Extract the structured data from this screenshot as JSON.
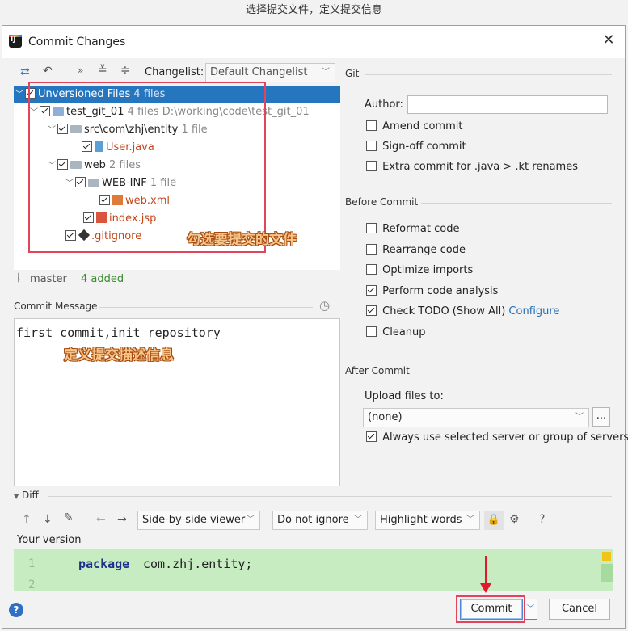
{
  "caption": "选择提交文件，定义提交信息",
  "window": {
    "title": "Commit Changes"
  },
  "toolbar": {
    "changelist_label": "Changelist:",
    "changelist_value": "Default Changelist"
  },
  "tree": {
    "root": {
      "label": "Unversioned Files",
      "count": "4 files"
    },
    "module": {
      "label": "test_git_01",
      "count": "4 files",
      "path": "D:\\working\\code\\test_git_01"
    },
    "pkg": {
      "label": "src\\com\\zhj\\entity",
      "count": "1 file"
    },
    "user_java": "User.java",
    "web": {
      "label": "web",
      "count": "2 files"
    },
    "webinf": {
      "label": "WEB-INF",
      "count": "1 file"
    },
    "web_xml": "web.xml",
    "index_jsp": "index.jsp",
    "gitignore": ".gitignore"
  },
  "annotations": {
    "select_files": "勾选要提交的文件",
    "define_message": "定义提交描述信息"
  },
  "status": {
    "branch": "master",
    "added": "4 added"
  },
  "commit_message": {
    "label": "Commit Message",
    "text": "first commit,init repository"
  },
  "git": {
    "section": "Git",
    "author_label": "Author:",
    "amend": "Amend commit",
    "signoff": "Sign-off commit",
    "extra": "Extra commit for .java > .kt renames"
  },
  "before_commit": {
    "section": "Before Commit",
    "reformat": "Reformat code",
    "rearrange": "Rearrange code",
    "optimize": "Optimize imports",
    "analysis": "Perform code analysis",
    "todo": "Check TODO (Show All)",
    "configure": "Configure",
    "cleanup": "Cleanup"
  },
  "after_commit": {
    "section": "After Commit",
    "upload_label": "Upload files to:",
    "upload_value": "(none)",
    "browse": "...",
    "always": "Always use selected server or group of servers"
  },
  "diff": {
    "section": "Diff",
    "viewer": "Side-by-side viewer",
    "ignore": "Do not ignore",
    "highlight": "Highlight words",
    "question": "?",
    "your_version": "Your version",
    "line1_num": "1",
    "line2_num": "2",
    "keyword": "package",
    "code": "com.zhj.entity;"
  },
  "footer": {
    "commit": "Commit",
    "cancel": "Cancel",
    "help": "?"
  }
}
